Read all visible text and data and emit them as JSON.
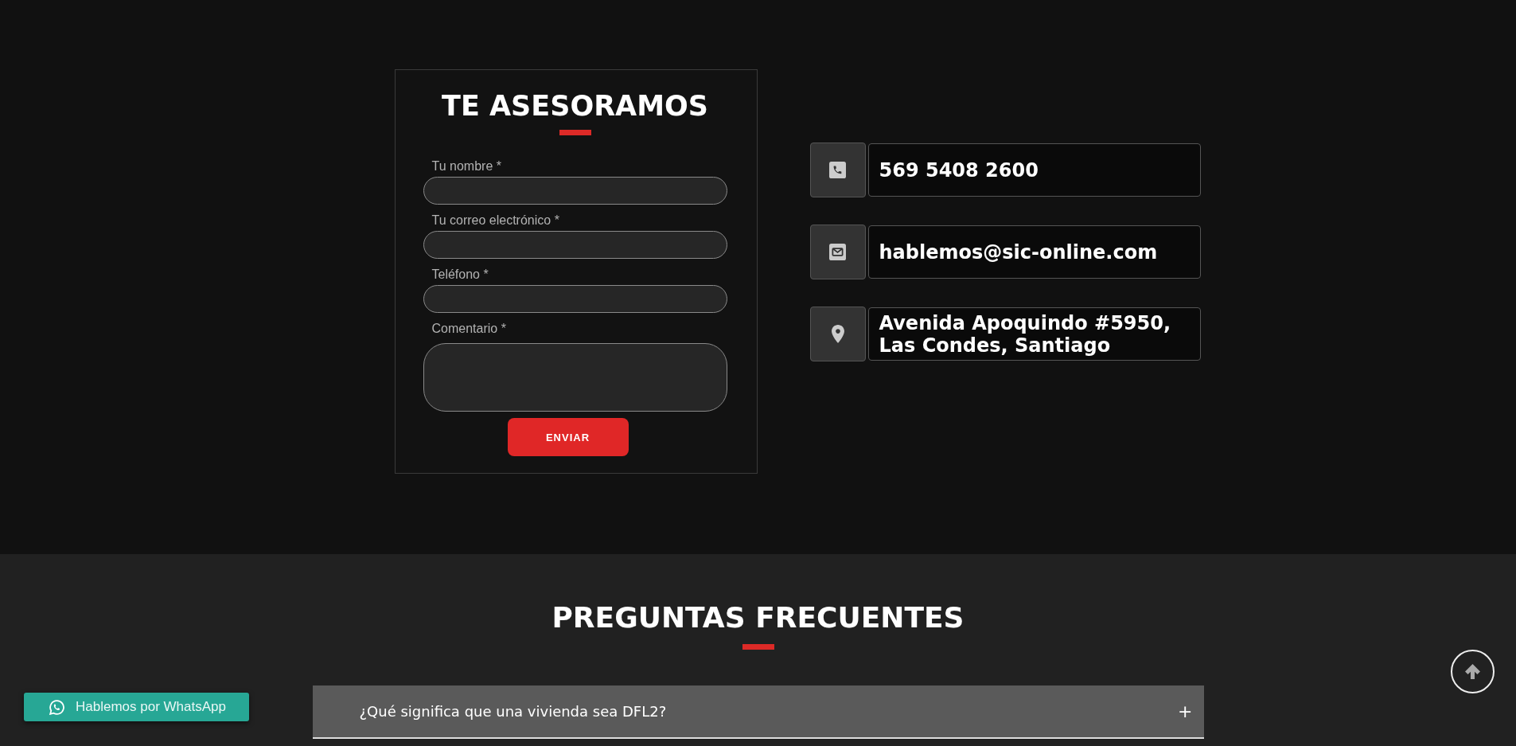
{
  "contact_form": {
    "title": "TE ASESORAMOS",
    "fields": [
      {
        "label": "Tu nombre *",
        "kind": "text"
      },
      {
        "label": "Tu correo electrónico *",
        "kind": "text"
      },
      {
        "label": "Teléfono *",
        "kind": "text"
      },
      {
        "label": "Comentario *",
        "kind": "textarea"
      }
    ],
    "submit_button": "ENVIAR"
  },
  "contact_info": [
    {
      "kind": "phone",
      "text": "569 5408 2600"
    },
    {
      "kind": "email",
      "text": "hablemos@sic-online.com"
    },
    {
      "kind": "address",
      "text": "Avenida Apoquindo #5950, Las Condes, Santiago"
    }
  ],
  "faq": {
    "title": "PREGUNTAS FRECUENTES",
    "items": [
      {
        "question": "¿Qué significa que una vivienda sea DFL2?",
        "toggle": "+"
      }
    ]
  },
  "whatsapp_button": {
    "label": "Hablemos por WhatsApp"
  }
}
